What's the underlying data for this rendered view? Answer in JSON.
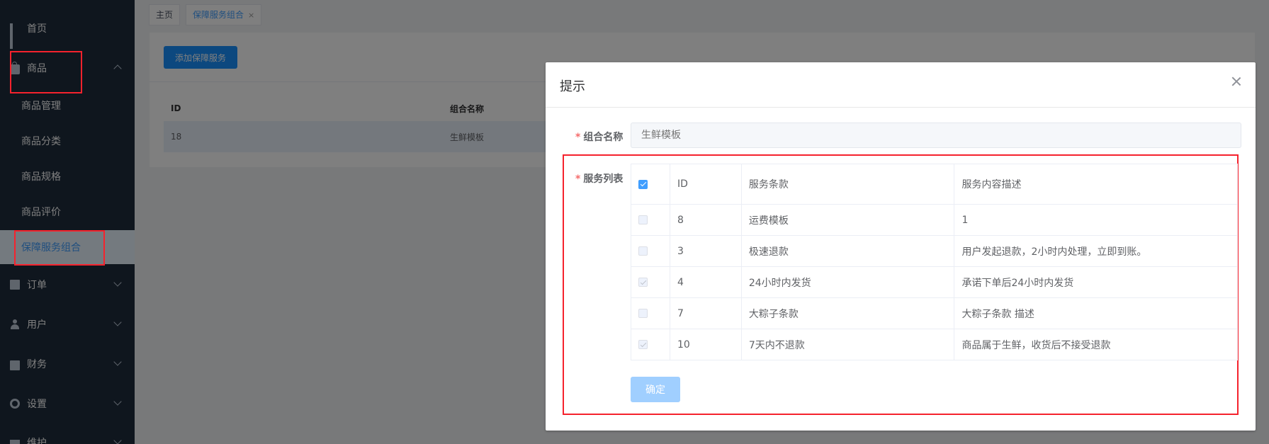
{
  "sidebar": {
    "items": [
      {
        "label": "首页",
        "icon": "grid-icon"
      },
      {
        "label": "商品",
        "icon": "shopping-bag-icon",
        "expanded": true
      },
      {
        "label": "订单",
        "icon": "clipboard-icon"
      },
      {
        "label": "用户",
        "icon": "user-icon"
      },
      {
        "label": "财务",
        "icon": "wallet-icon"
      },
      {
        "label": "设置",
        "icon": "gear-icon"
      },
      {
        "label": "维护",
        "icon": "box-icon"
      }
    ],
    "submenu": [
      {
        "label": "商品管理"
      },
      {
        "label": "商品分类"
      },
      {
        "label": "商品规格"
      },
      {
        "label": "商品评价"
      },
      {
        "label": "保障服务组合",
        "active": true
      }
    ]
  },
  "tabs": {
    "home": "主页",
    "current": "保障服务组合",
    "close": "×"
  },
  "main": {
    "add_button": "添加保障服务",
    "table": {
      "headers": [
        "ID",
        "组合名称"
      ],
      "rows": [
        {
          "id": "18",
          "name": "生鲜模板"
        }
      ]
    }
  },
  "dialog": {
    "title": "提示",
    "name_label": "组合名称",
    "name_placeholder": "生鲜模板",
    "list_label": "服务列表",
    "required_mark": "*",
    "table": {
      "headers": [
        "ID",
        "服务条款",
        "服务内容描述"
      ],
      "rows": [
        {
          "id": "8",
          "term": "运费模板",
          "desc": "1",
          "checked": false
        },
        {
          "id": "3",
          "term": "极速退款",
          "desc": "用户发起退款，2小时内处理，立即到账。",
          "checked": false
        },
        {
          "id": "4",
          "term": "24小时内发货",
          "desc": "承诺下单后24小时内发货",
          "checked": true
        },
        {
          "id": "7",
          "term": "大粽子条款",
          "desc": "大粽子条款 描述",
          "checked": false
        },
        {
          "id": "10",
          "term": "7天内不退款",
          "desc": "商品属于生鲜，收货后不接受退款",
          "checked": true
        }
      ]
    },
    "confirm_button": "确定"
  },
  "colors": {
    "sidebar_bg": "#1f2d3d",
    "primary": "#1890ff",
    "highlight_box": "#f5222d",
    "confirm_disabled": "#a0cfff"
  }
}
